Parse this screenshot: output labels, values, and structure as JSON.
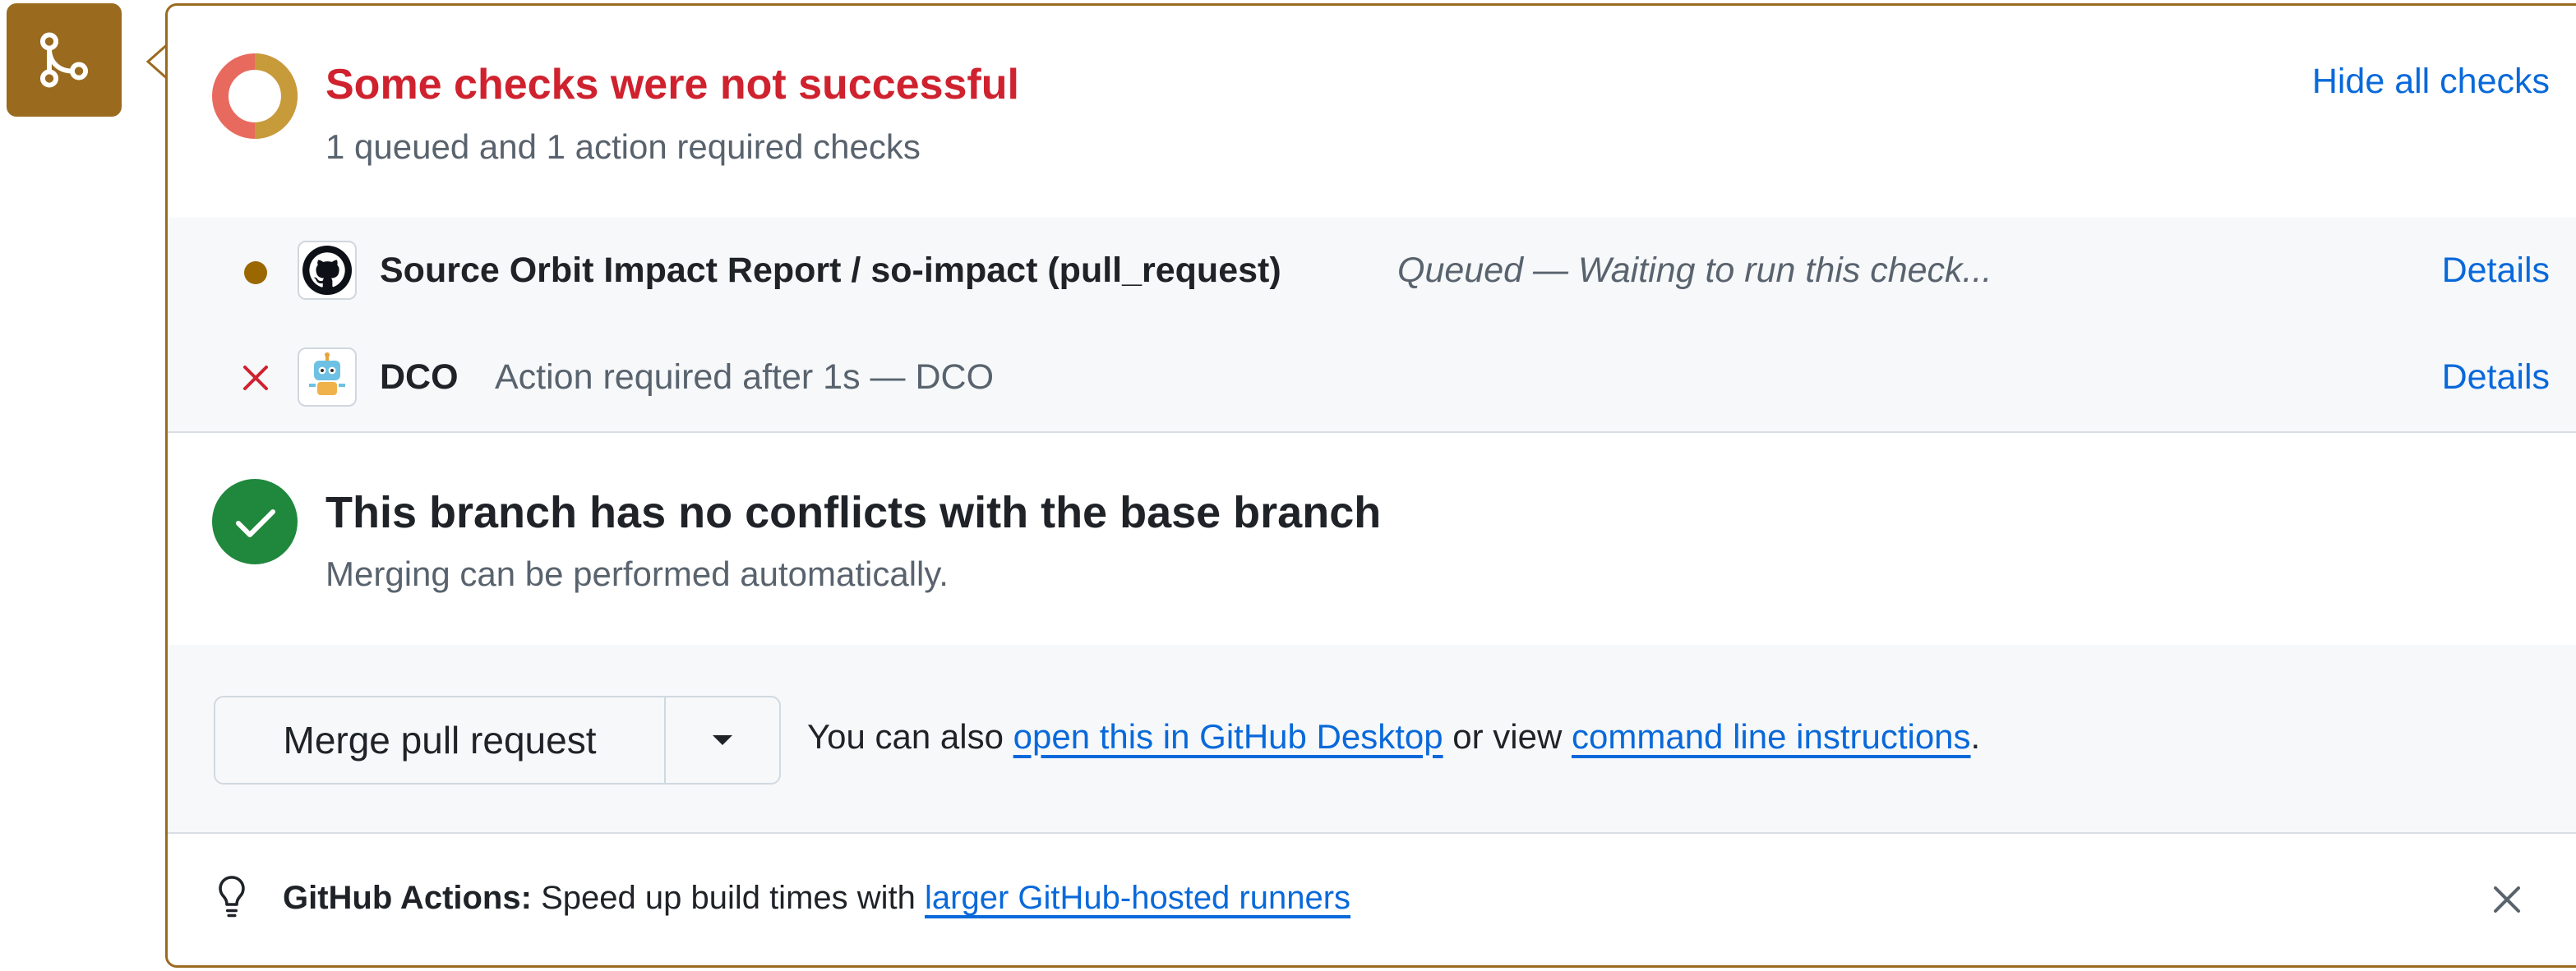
{
  "header": {
    "title": "Some checks were not successful",
    "subtitle": "1 queued and 1 action required checks",
    "hide_label": "Hide all checks"
  },
  "checks": [
    {
      "name": "Source Orbit Impact Report / so-impact (pull_request)",
      "status": "Queued — Waiting to run this check...",
      "details_label": "Details",
      "state_icon": "queued-dot-icon",
      "app_icon": "github-logo-icon"
    },
    {
      "name": "DCO",
      "status": "Action required after 1s — DCO",
      "details_label": "Details",
      "state_icon": "x-icon",
      "app_icon": "dco-robot-icon"
    }
  ],
  "branch": {
    "title": "This branch has no conflicts with the base branch",
    "subtitle": "Merging can be performed automatically."
  },
  "merge": {
    "button_label": "Merge pull request",
    "prefix": "You can also",
    "desktop_link": "open this in GitHub Desktop",
    "middle": "or view",
    "cli_link": "command line instructions",
    "suffix": "."
  },
  "tip": {
    "label": "GitHub Actions:",
    "text": "Speed up build times with",
    "link": "larger GitHub-hosted runners"
  },
  "colors": {
    "accent_merge": "#9a6a1f",
    "error": "#cf222e",
    "success": "#1f883d",
    "link": "#0969da",
    "queued": "#9a6700"
  }
}
